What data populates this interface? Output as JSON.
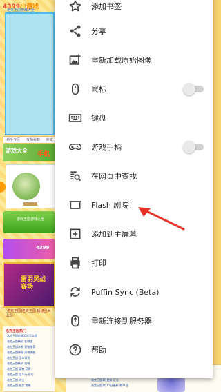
{
  "background_page": {
    "logo_text": "4399",
    "logo_suffix": "小游戏",
    "game_link": "洛克王国游戏大全",
    "strip_tabs": [
      "新手专区",
      "攻略秘籍",
      "荣耀"
    ],
    "banner_text": "游戏大全",
    "banner_text2": "手机",
    "green_tab_text": "游戏王国游戏大全",
    "purple_text": "4399",
    "poster_text": "雷羽灵战客场",
    "caption": "[洛克王国]洛克王国 超级强大出现!",
    "list_title": "洛克王国热门",
    "list_lines": [
      "洛克王国的雷羽灵怎么得",
      "洛克王国精灵 在哪里",
      "洛克王国水系 宠物推荐",
      "洛克王国神宠 宠物技能",
      "洛克王国 怎么得到",
      "洛克王国精灵 攻略",
      "洛克王国 宠物 获得",
      "洛克王国 怎么玩 技巧",
      "洛克王国 大全",
      "洛克王国 任务 攻略"
    ],
    "bottom_lines": [
      "洛克王国18日更新 活动汇总",
      "洛克王国3月3日更新一 第三届",
      "洛克王国2月更新 汇总",
      "洛克王国2月17日更新 第31届"
    ]
  },
  "menu": {
    "items": [
      {
        "key": "bookmark",
        "label": "添加书签",
        "icon": "star-icon"
      },
      {
        "key": "share",
        "label": "分享",
        "icon": "share-icon"
      },
      {
        "key": "reload-images",
        "label": "重新加载原始图像",
        "icon": "image-reload-icon"
      },
      {
        "key": "mouse",
        "label": "鼠标",
        "icon": "mouse-icon",
        "toggle": false
      },
      {
        "key": "keyboard",
        "label": "键盘",
        "icon": "keyboard-icon"
      },
      {
        "key": "gamepad",
        "label": "游戏手柄",
        "icon": "gamepad-icon",
        "toggle": false
      },
      {
        "key": "find",
        "label": "在网页中查找",
        "icon": "find-in-page-icon"
      },
      {
        "key": "flash",
        "label": "Flash 剧院",
        "icon": "flash-theater-icon"
      },
      {
        "key": "homescreen",
        "label": "添加到主屏幕",
        "icon": "add-box-icon"
      },
      {
        "key": "print",
        "label": "打印",
        "icon": "print-icon"
      },
      {
        "key": "sync",
        "label": "Puffin Sync (Beta)",
        "icon": "sync-icon"
      },
      {
        "key": "reconnect",
        "label": "重新连接到服务器",
        "icon": "reconnect-icon"
      },
      {
        "key": "help",
        "label": "帮助",
        "icon": "help-icon"
      }
    ]
  },
  "annotation": {
    "color": "#e8332a",
    "points_to": "Flash 剧院"
  }
}
